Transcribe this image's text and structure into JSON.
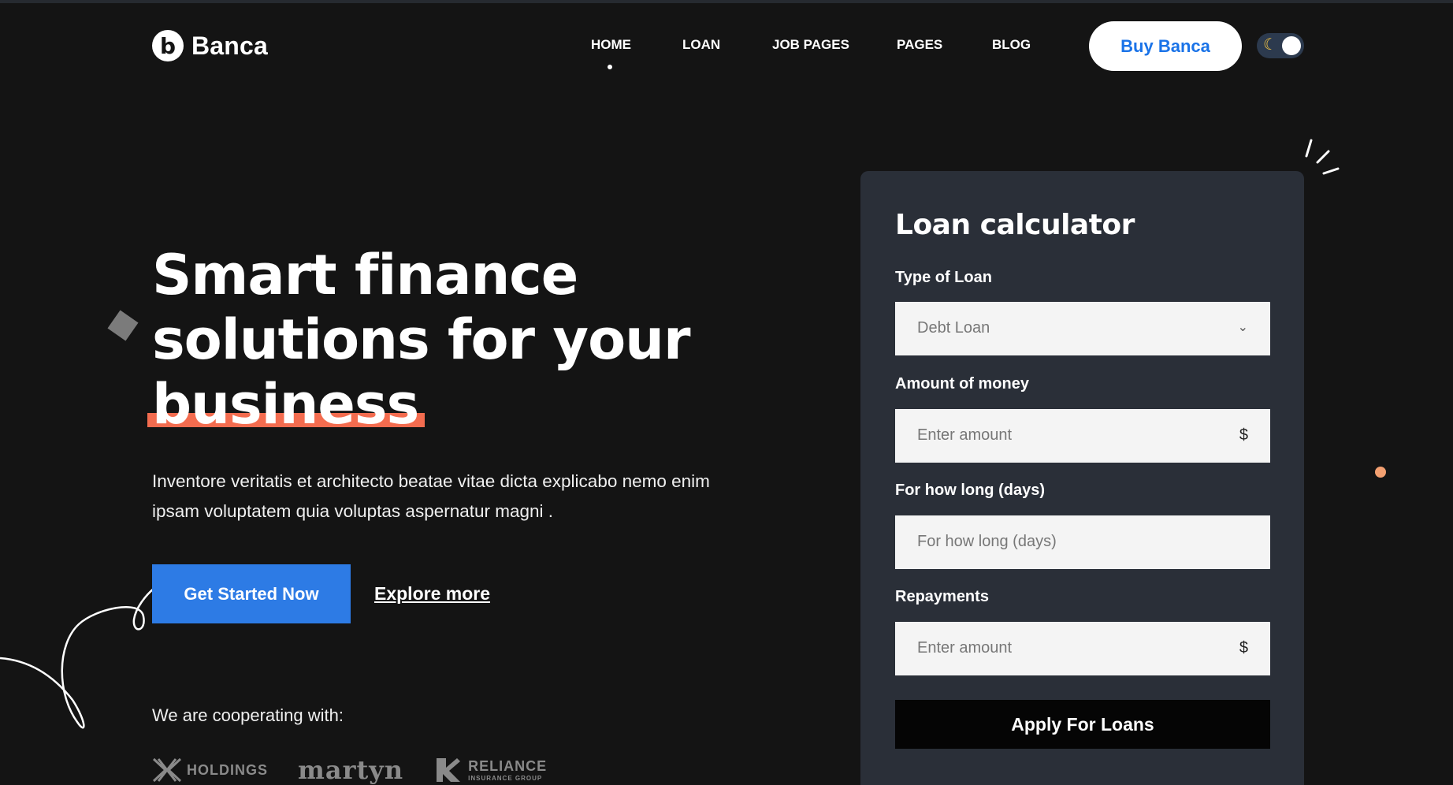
{
  "brand": {
    "name": "Banca",
    "logo_letter": "b",
    "accent": "#2d7be5",
    "highlight": "#f36c4f"
  },
  "nav": {
    "items": [
      {
        "label": "HOME",
        "active": true
      },
      {
        "label": "LOAN"
      },
      {
        "label": "JOB PAGES"
      },
      {
        "label": "PAGES"
      },
      {
        "label": "BLOG"
      }
    ],
    "buy_label": "Buy Banca",
    "theme_toggle_icon": "moon-icon"
  },
  "hero": {
    "title_line1": "Smart finance",
    "title_line2": "solutions for your",
    "title_line3": "business",
    "description": "Inventore veritatis et architecto beatae vitae dicta explicabo nemo enim ipsam voluptatem quia voluptas aspernatur magni .",
    "cta_label": "Get Started Now",
    "explore_label": "Explore more",
    "cooperating_label": "We are cooperating with:",
    "partners": {
      "holdings": "HOLDINGS",
      "martyn": "martyn",
      "reliance": "RELIANCE",
      "reliance_sub": "INSURANCE GROUP"
    }
  },
  "calculator": {
    "title": "Loan calculator",
    "type_label": "Type of Loan",
    "type_value": "Debt Loan",
    "amount_label": "Amount of money",
    "amount_placeholder": "Enter amount",
    "currency": "$",
    "days_label": "For how long (days)",
    "days_placeholder": "For how long (days)",
    "repay_label": "Repayments",
    "repay_placeholder": "Enter amount",
    "apply_label": "Apply For Loans"
  }
}
